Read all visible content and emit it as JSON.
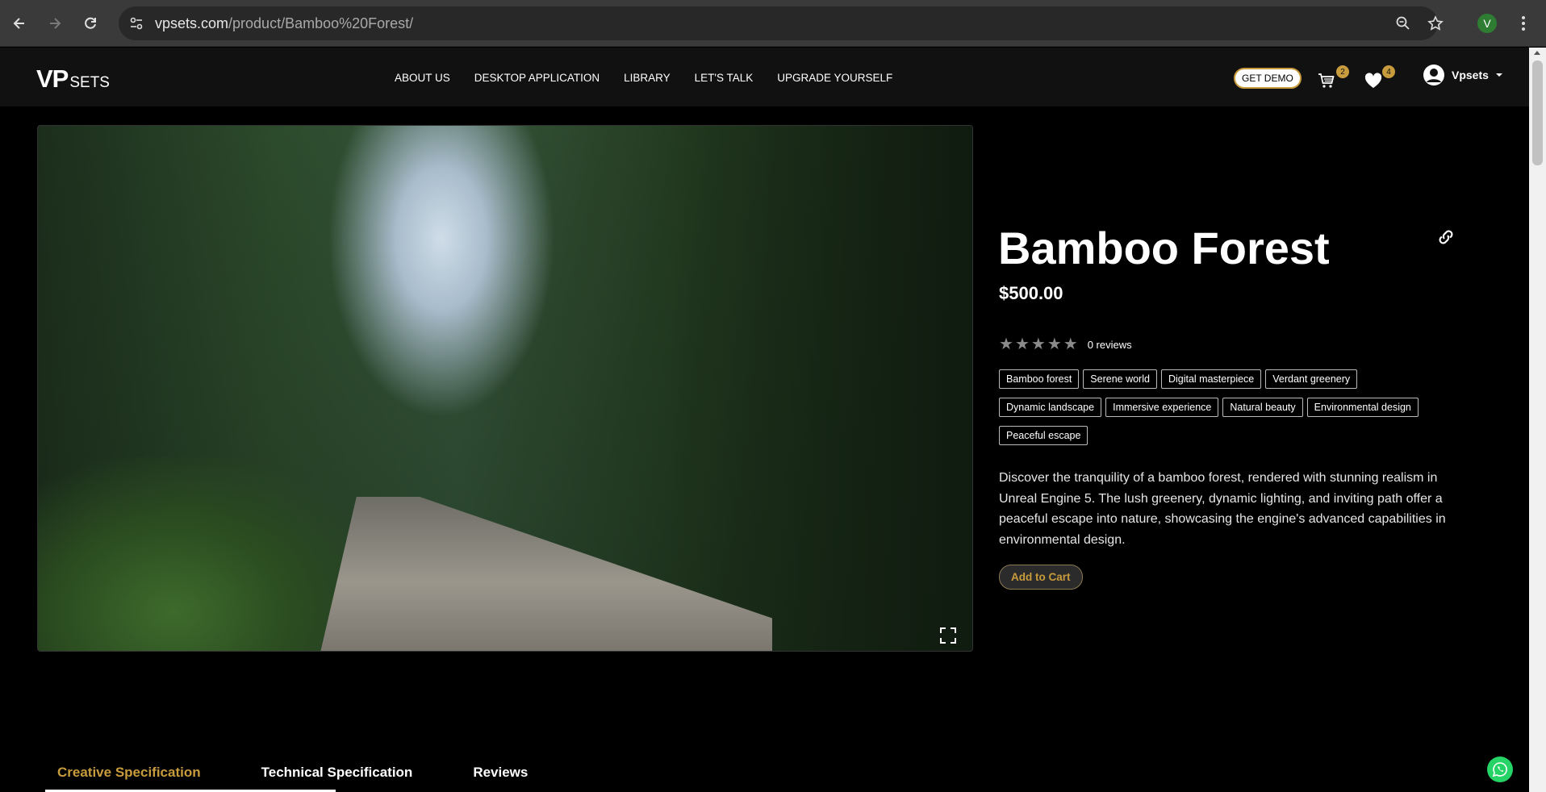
{
  "browser": {
    "url_domain": "vpsets.com",
    "url_path": "/product/Bamboo%20Forest/",
    "profile_initial": "V"
  },
  "header": {
    "logo_vp": "VP",
    "logo_sets": "SETS",
    "nav": [
      "ABOUT US",
      "DESKTOP APPLICATION",
      "LIBRARY",
      "LET'S TALK",
      "UPGRADE YOURSELF"
    ],
    "demo_label": "GET DEMO",
    "cart_count": "2",
    "wishlist_count": "4",
    "user_name": "Vpsets"
  },
  "product": {
    "title": "Bamboo Forest",
    "price": "$500.00",
    "rating_value": 0,
    "reviews_label": "0 reviews",
    "tags": [
      "Bamboo forest",
      "Serene world",
      "Digital masterpiece",
      "Verdant greenery",
      "Dynamic landscape",
      "Immersive experience",
      "Natural beauty",
      "Environmental design",
      "Peaceful escape"
    ],
    "description": "Discover the tranquility of a bamboo forest, rendered with stunning realism in Unreal Engine 5. The lush greenery, dynamic lighting, and inviting path offer a peaceful escape into nature, showcasing the engine's advanced capabilities in environmental design.",
    "add_to_cart_label": "Add to Cart"
  },
  "tabs": [
    {
      "label": "Creative Specification",
      "active": true
    },
    {
      "label": "Technical Specification",
      "active": false
    },
    {
      "label": "Reviews",
      "active": false
    }
  ],
  "colors": {
    "accent": "#c89b3c",
    "background": "#000000",
    "header_bg": "#111111"
  },
  "icons": {
    "back": "arrow-left-icon",
    "forward": "arrow-right-icon",
    "reload": "reload-icon",
    "site_info": "tune-icon",
    "zoom": "zoom-icon",
    "bookmark": "star-icon",
    "menu": "kebab-icon",
    "cart": "cart-icon",
    "wishlist": "heart-icon",
    "user": "user-icon",
    "share": "link-icon",
    "fullscreen": "fullscreen-icon",
    "chat": "whatsapp-icon"
  }
}
